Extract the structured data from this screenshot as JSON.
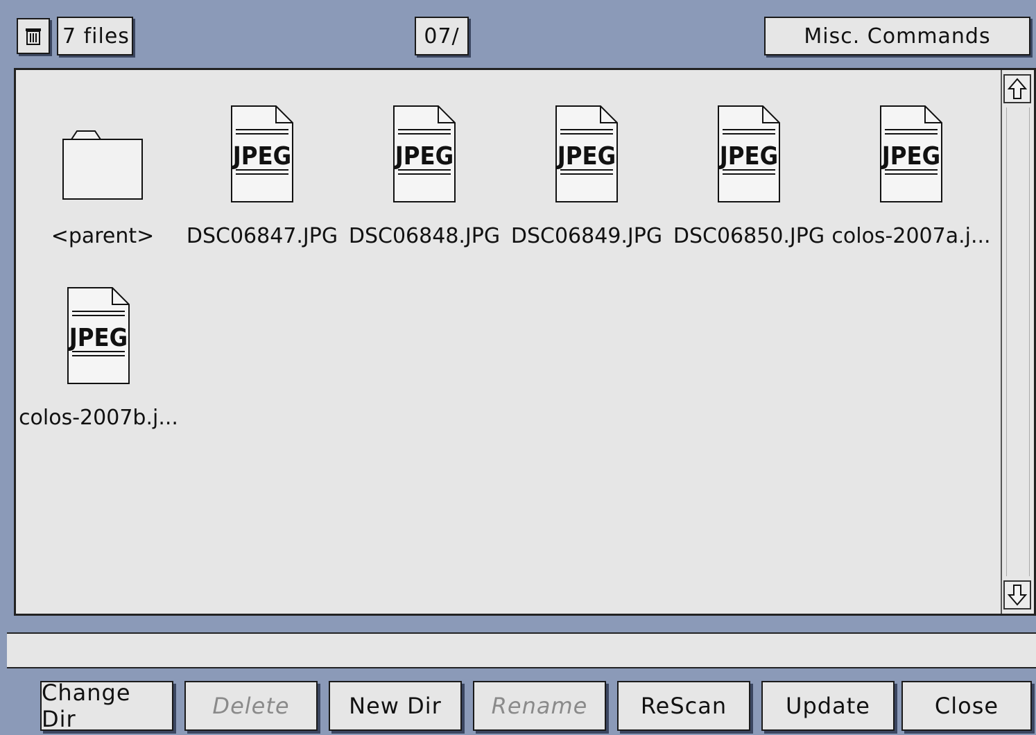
{
  "header": {
    "trash_icon": "trash-icon",
    "file_count": "7 files",
    "path": "07/",
    "misc_commands": "Misc. Commands"
  },
  "files": [
    {
      "name": "<parent>",
      "type": "folder"
    },
    {
      "name": "DSC06847.JPG",
      "type": "jpeg",
      "badge": "JPEG"
    },
    {
      "name": "DSC06848.JPG",
      "type": "jpeg",
      "badge": "JPEG"
    },
    {
      "name": "DSC06849.JPG",
      "type": "jpeg",
      "badge": "JPEG"
    },
    {
      "name": "DSC06850.JPG",
      "type": "jpeg",
      "badge": "JPEG"
    },
    {
      "name": "colos-2007a.j...",
      "type": "jpeg",
      "badge": "JPEG"
    },
    {
      "name": "colos-2007b.j...",
      "type": "jpeg",
      "badge": "JPEG"
    }
  ],
  "scrollbar": {
    "up_icon": "arrow-up-icon",
    "down_icon": "arrow-down-icon"
  },
  "status_text": "",
  "buttons": [
    {
      "label": "Change Dir",
      "enabled": true
    },
    {
      "label": "Delete",
      "enabled": false
    },
    {
      "label": "New Dir",
      "enabled": true
    },
    {
      "label": "Rename",
      "enabled": false
    },
    {
      "label": "ReScan",
      "enabled": true
    },
    {
      "label": "Update",
      "enabled": true
    },
    {
      "label": "Close",
      "enabled": true
    }
  ],
  "colors": {
    "background": "#8b9ab8",
    "panel": "#e6e6e6",
    "shadow": "#3b4660"
  }
}
